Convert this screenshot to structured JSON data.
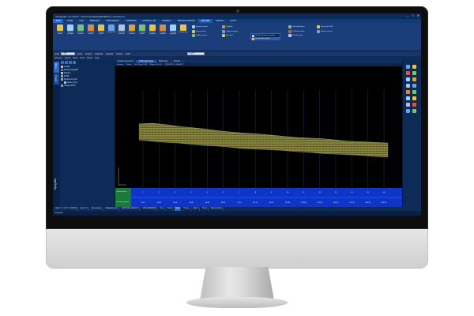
{
  "app": {
    "title": "Topografia - [C:\\Users\\...\\Documents\\Dettaglio\\Rilievo_nuvola.pro]",
    "window_controls": [
      "–",
      "□",
      "✕"
    ]
  },
  "menu": [
    "FILE",
    "HOME",
    "CAD",
    "IMMAGINI",
    "TOPOGRAFIA",
    "CAMPIONA",
    "MODELLO 3D",
    "MODELLI",
    "PROGETTAZIONE",
    "RASTER",
    "PROFILI",
    "AIUTO"
  ],
  "menu_active": "RASTER",
  "ribbon": {
    "buttons": [
      {
        "label": "Sezioni profili",
        "color": "#e6c34a"
      },
      {
        "label": "Sezioni multiple",
        "color": "#9fd0ff"
      },
      {
        "label": "Inserisci sezione",
        "color": "#77c37a"
      },
      {
        "label": "Visualizza profilo",
        "color": "#d68a4c"
      },
      {
        "label": "Disegna profili",
        "color": "#e6c34a"
      },
      {
        "label": "Sezioni 3D",
        "color": "#6aa3e6"
      },
      {
        "label": "Ripristina sezione",
        "color": "#b0c4de"
      },
      {
        "label": "Profilo su sezione",
        "color": "#e0a040"
      },
      {
        "label": "Visualizza profilo",
        "color": "#77c37a"
      },
      {
        "label": "Sezione progetto",
        "color": "#e6c34a"
      },
      {
        "label": "Progetto stradale",
        "color": "#d68a4c"
      },
      {
        "label": "Disegna progetto",
        "color": "#9fd0ff"
      },
      {
        "label": "Sezioni tipo",
        "color": "#e6c34a"
      }
    ],
    "small_a": [
      "Esporta sezioni",
      "Quote profilo",
      "Profilo sezioni"
    ],
    "small_b": [
      "Progetto",
      "Griglia progetto",
      "Raccordi"
    ],
    "small_c": [
      "Volumi/superfici",
      "DTM da sezioni",
      "File di sezioni"
    ],
    "small_d": [
      "Importa da DXF",
      "Esporta sezioni"
    ],
    "dropdown": [
      "Calcola sezioni su nuvola",
      "Crea profilo nuvola"
    ]
  },
  "toolbar2": {
    "scale_label": "Scala",
    "scale_value": "1:500",
    "items": [
      "Livello",
      "Sezione",
      "Proprietà",
      "Vista 3D",
      "Sezioni",
      "Colori"
    ],
    "layer_value": "Layer 0"
  },
  "toolbar3": [
    "Selezione",
    "Sposta",
    "Ruota",
    "Zoom",
    "Misura",
    "Snap"
  ],
  "left_panel": {
    "tabs": [
      "Rilievo",
      "Progetto"
    ],
    "label": "Topografia",
    "tree": [
      {
        "label": "Gruppi",
        "color": "#e6c34a"
      },
      {
        "label": "Punti topografici",
        "color": "#d9534f"
      },
      {
        "label": "Sezioni",
        "color": "#9fd0ff"
      },
      {
        "label": "Profili",
        "color": "#77c37a"
      },
      {
        "label": "Nuvole di punti",
        "color": "#e0a040"
      },
      {
        "label": "Cloud_Test",
        "color": "#b0c4de"
      },
      {
        "label": "Gruppo DTM",
        "color": "#6aa3e6"
      }
    ]
  },
  "viewport": {
    "tabs": [
      "Sezione del terreno",
      "Profilo del terreno",
      "Planimetria",
      "Vista 3D"
    ],
    "active_tab": "Profilo del terreno",
    "tools": [
      "Sezione",
      "Profilo",
      "Dist. Piani 1:500",
      "Rapp. alt 1:100",
      "PROGETTO_SAGGIO 1"
    ]
  },
  "chart_data": {
    "type": "area",
    "title": "",
    "xlabel": "",
    "ylabel": "",
    "band_left_labels": [
      "Quote terreno",
      "Distanze parziali"
    ],
    "band_numbers": [
      "0.00",
      "10.56",
      "22.16",
      "32.48",
      "44.89",
      "56.31",
      "71.10",
      "84.79",
      "95.67",
      "111.33",
      "132.35",
      "147.55",
      "159.70",
      "175.31",
      "189.10",
      "206.75"
    ],
    "band_numbers2": [
      "1",
      "2",
      "3",
      "4",
      "5",
      "6",
      "7",
      "8",
      "9",
      "10",
      "11",
      "12",
      "13",
      "14",
      "15",
      "16"
    ],
    "profile_top": [
      0.86,
      0.87,
      0.85,
      0.82,
      0.8,
      0.78,
      0.75,
      0.73,
      0.71,
      0.7,
      0.68,
      0.66,
      0.64,
      0.63,
      0.62,
      0.6,
      0.58,
      0.57,
      0.56,
      0.55
    ],
    "profile_bottom": [
      0.6,
      0.58,
      0.56,
      0.55,
      0.53,
      0.51,
      0.5,
      0.48,
      0.46,
      0.45,
      0.44,
      0.43,
      0.41,
      0.4,
      0.38,
      0.37,
      0.36,
      0.35,
      0.33,
      0.32
    ]
  },
  "statusbar": {
    "coords": "Nord: 1, Y: 34.7, Z: 264.36",
    "items": [
      "Elev: 0.0",
      "Da sessione",
      "Abbassamento",
      "SEZIONE_DEFAULT",
      "UTM-ETRF2000",
      "Orto",
      "Polar",
      "Snap",
      "Proiez.",
      "Ripris.",
      "Pieno",
      "Mano sinistra"
    ],
    "active": [
      "Snap"
    ]
  },
  "command_label": "Comando:",
  "right_tools": [
    "#6aa3e6",
    "#e6c34a",
    "#d9534f",
    "#77c37a",
    "#9fd0ff",
    "#e0a040",
    "#b0c4de",
    "#6aa3e6",
    "#d68a4c",
    "#77c37a",
    "#9fd0ff",
    "#e6c34a",
    "#b0c4de",
    "#d9534f",
    "#6aa3e6",
    "#77c37a"
  ]
}
